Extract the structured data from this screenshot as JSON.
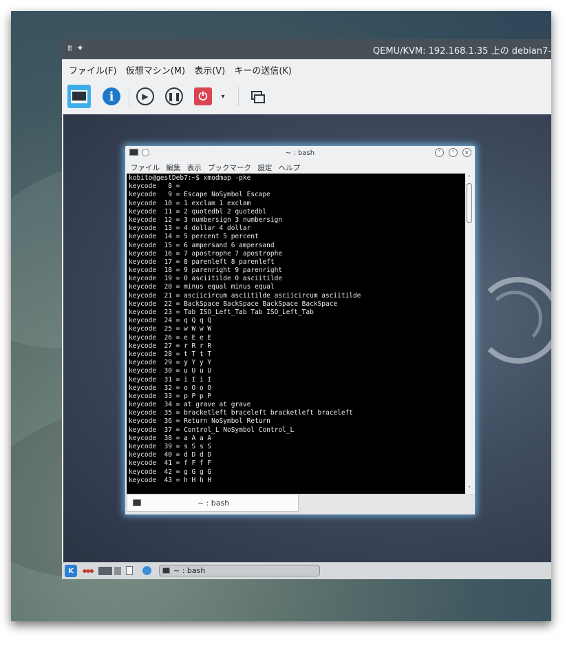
{
  "vm_window": {
    "title": "QEMU/KVM: 192.168.1.35 上の debian7-",
    "menu": [
      "ファイル(F)",
      "仮想マシン(M)",
      "表示(V)",
      "キーの送信(K)"
    ],
    "toolbar": {
      "icons": [
        "display-icon",
        "info-icon",
        "play-icon",
        "pause-icon",
        "power-icon",
        "dropdown-icon",
        "screenshot-icon"
      ],
      "info_glyph": "i",
      "play_glyph": "▶",
      "pause_glyph": "❚❚",
      "power_glyph": "⏻",
      "dropdown_glyph": "▾"
    }
  },
  "konsole": {
    "title": "~ : bash",
    "menu": [
      "ファイル",
      "編集",
      "表示",
      "ブックマーク",
      "設定",
      "ヘルプ"
    ],
    "window_buttons": [
      "˅",
      "˄",
      "×"
    ],
    "tab_label": "~ : bash",
    "terminal_lines": [
      "kobito@gestDeb7:~$ xmodmap -pke",
      "keycode   8 =",
      "keycode   9 = Escape NoSymbol Escape",
      "keycode  10 = 1 exclam 1 exclam",
      "keycode  11 = 2 quotedbl 2 quotedbl",
      "keycode  12 = 3 numbersign 3 numbersign",
      "keycode  13 = 4 dollar 4 dollar",
      "keycode  14 = 5 percent 5 percent",
      "keycode  15 = 6 ampersand 6 ampersand",
      "keycode  16 = 7 apostrophe 7 apostrophe",
      "keycode  17 = 8 parenleft 8 parenleft",
      "keycode  18 = 9 parenright 9 parenright",
      "keycode  19 = 0 asciitilde 0 asciitilde",
      "keycode  20 = minus equal minus equal",
      "keycode  21 = asciicircum asciitilde asciicircum asciitilde",
      "keycode  22 = BackSpace BackSpace BackSpace BackSpace",
      "keycode  23 = Tab ISO_Left_Tab Tab ISO_Left_Tab",
      "keycode  24 = q Q q Q",
      "keycode  25 = w W w W",
      "keycode  26 = e E e E",
      "keycode  27 = r R r R",
      "keycode  28 = t T t T",
      "keycode  29 = y Y y Y",
      "keycode  30 = u U u U",
      "keycode  31 = i I i I",
      "keycode  32 = o O o O",
      "keycode  33 = p P p P",
      "keycode  34 = at grave at grave",
      "keycode  35 = bracketleft braceleft bracketleft braceleft",
      "keycode  36 = Return NoSymbol Return",
      "keycode  37 = Control_L NoSymbol Control_L",
      "keycode  38 = a A a A",
      "keycode  39 = s S s S",
      "keycode  40 = d D d D",
      "keycode  41 = f F f F",
      "keycode  42 = g G g G",
      "keycode  43 = h H h H"
    ]
  },
  "taskbar": {
    "kde_glyph": "K",
    "tray_dots": "●●●",
    "task_label": "~ : bash"
  },
  "colors": {
    "kde_blue": "#3daee9",
    "terminal_bg": "#000000",
    "power_red": "#da4453",
    "titlebar": "#475057"
  }
}
